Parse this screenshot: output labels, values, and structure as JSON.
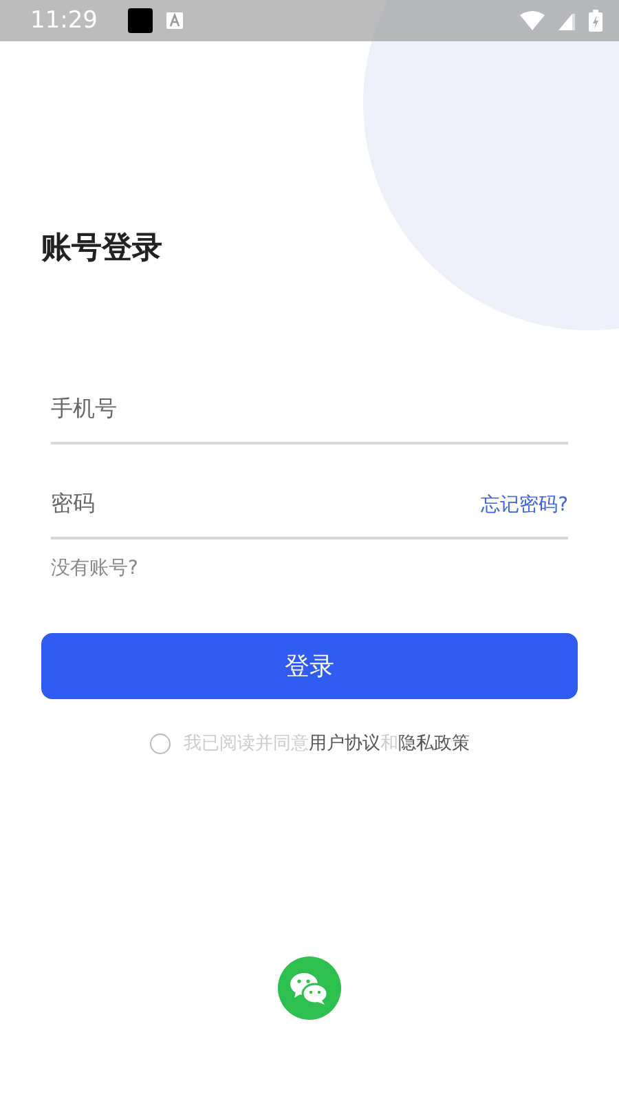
{
  "status_bar": {
    "time": "11:29"
  },
  "title": "账号登录",
  "phone_field": {
    "placeholder": "手机号"
  },
  "password_field": {
    "placeholder": "密码"
  },
  "forgot_link": "忘记密码?",
  "register_link": "没有账号?",
  "login_button": "登录",
  "agreement": {
    "checked": false,
    "parts": [
      {
        "kind": "plain",
        "text": "我已阅读并同意"
      },
      {
        "kind": "link",
        "text": "用户协议"
      },
      {
        "kind": "plain",
        "text": "和"
      },
      {
        "kind": "link",
        "text": "隐私政策"
      }
    ]
  }
}
